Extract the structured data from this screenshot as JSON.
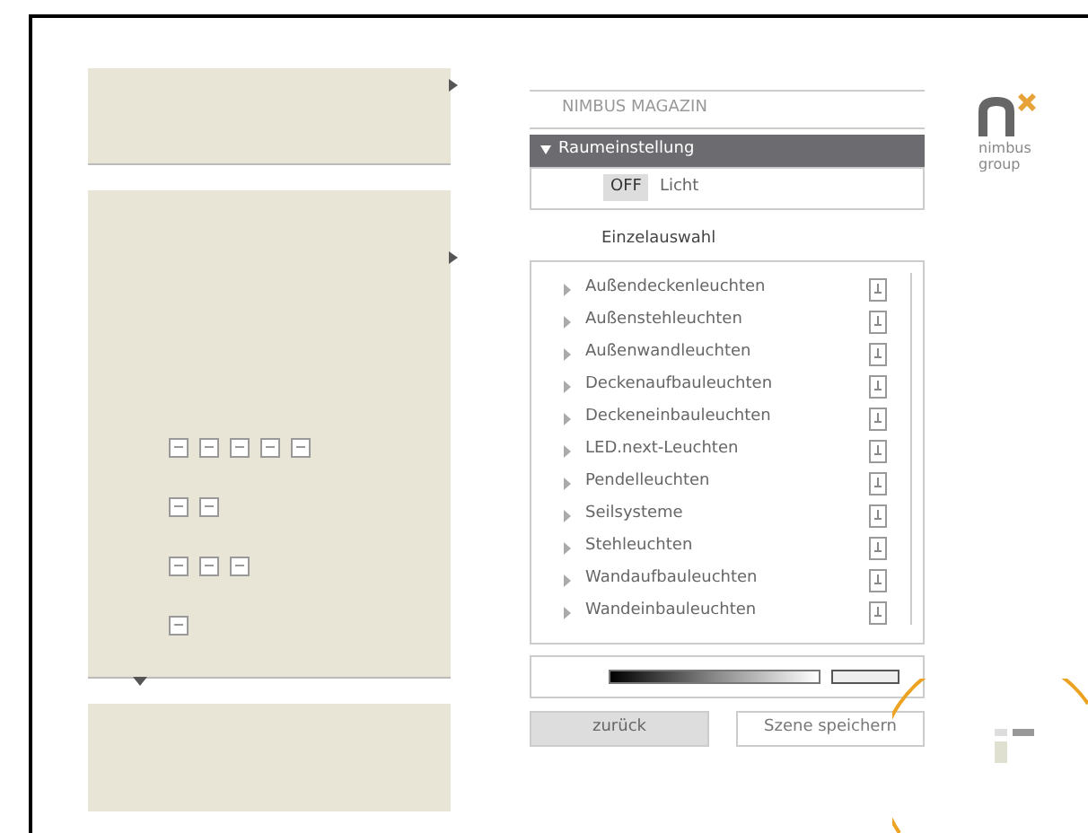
{
  "magazine_title": "NIMBUS MAGAZIN",
  "section": {
    "label": "Raumeinstellung",
    "expanded": true
  },
  "light": {
    "toggle": "OFF",
    "label": "Licht",
    "on": false
  },
  "list_title": "Einzelauswahl",
  "items": [
    {
      "label": "Außendeckenleuchten"
    },
    {
      "label": "Außenstehleuchten"
    },
    {
      "label": "Außenwandleuchten"
    },
    {
      "label": "Deckenaufbauleuchten"
    },
    {
      "label": "Deckeneinbauleuchten"
    },
    {
      "label": "LED.next-Leuchten"
    },
    {
      "label": "Pendelleuchten"
    },
    {
      "label": "Seilsysteme"
    },
    {
      "label": "Stehleuchten"
    },
    {
      "label": "Wandaufbauleuchten"
    },
    {
      "label": "Wandeinbauleuchten"
    }
  ],
  "buttons": [
    {
      "label": "zurück",
      "kind": "secondary"
    },
    {
      "label": "Szene speichern",
      "kind": "primary"
    }
  ],
  "logo": {
    "line_1": "nimbus",
    "line_2": "group"
  }
}
